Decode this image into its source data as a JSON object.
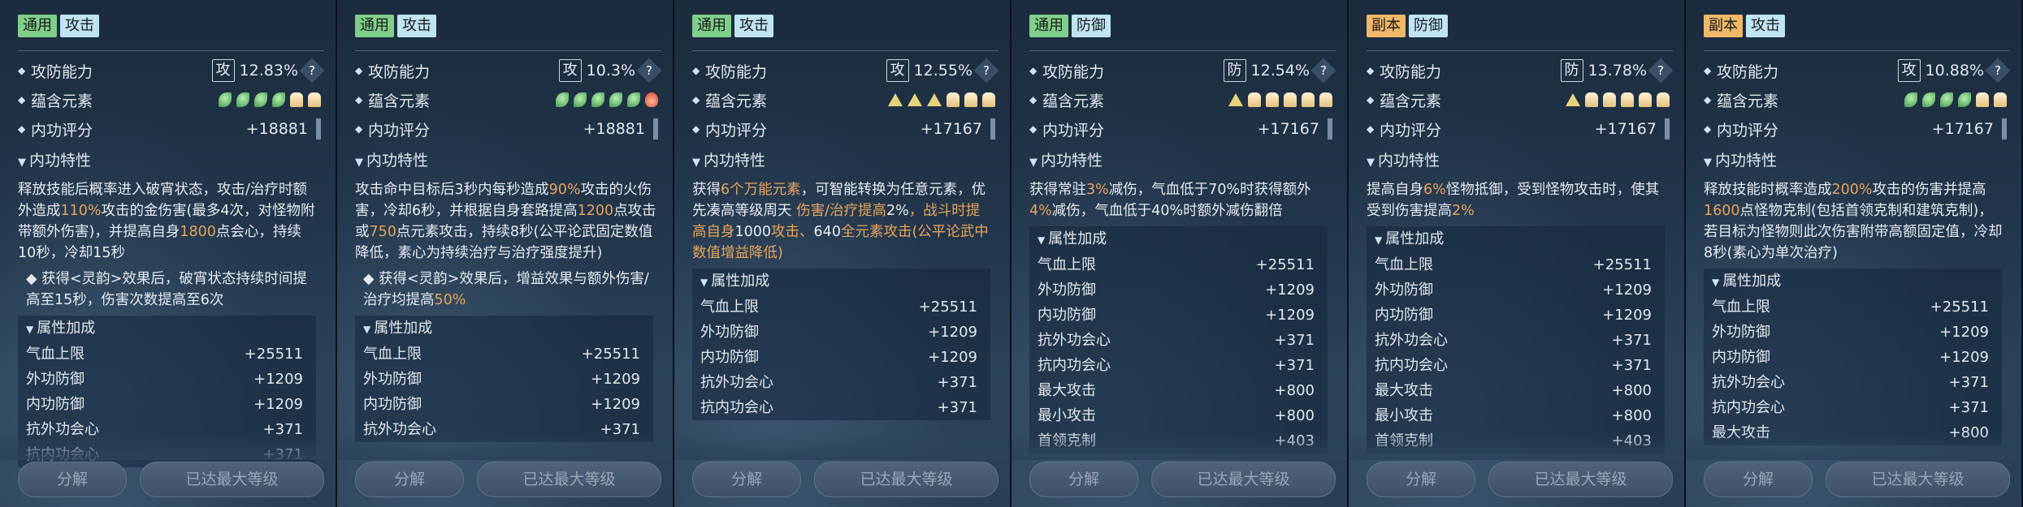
{
  "cards": [
    {
      "tags": [
        "通用",
        "攻击"
      ],
      "labels": {
        "power": "攻防能力",
        "elements": "蕴含元素",
        "score": "内功评分",
        "traits": "内功特性",
        "attrs": "属性加成"
      },
      "power_badge": "攻",
      "power_value": "12.83%",
      "qmark": "?",
      "elements": [
        "leaf",
        "leaf",
        "leaf",
        "leaf",
        "bell",
        "bell"
      ],
      "score": "+18881",
      "desc_parts": [
        "释放技能后概率进入破宵状态，攻击/治疗时额外造成",
        "110%",
        "攻击的金伤害(最多4次，对怪物附带额外伤害)，并提高自身",
        "1800",
        "点会心，持续10秒，冷却15秒"
      ],
      "sub": "◆ 获得<灵韵>效果后，破宵状态持续时间提高至15秒，伤害次数提高至6次",
      "attrs": [
        [
          "气血上限",
          "+25511"
        ],
        [
          "外功防御",
          "+1209"
        ],
        [
          "内功防御",
          "+1209"
        ],
        [
          "抗外功会心",
          "+371"
        ],
        [
          "抗内功会心",
          "+371"
        ]
      ],
      "btn_break": "分解",
      "btn_max": "已达最大等级"
    },
    {
      "tags": [
        "通用",
        "攻击"
      ],
      "labels": {
        "power": "攻防能力",
        "elements": "蕴含元素",
        "score": "内功评分",
        "traits": "内功特性",
        "attrs": "属性加成"
      },
      "power_badge": "攻",
      "power_value": "10.3%",
      "qmark": "?",
      "elements": [
        "leaf",
        "leaf",
        "leaf",
        "leaf",
        "leaf",
        "fire"
      ],
      "score": "+18881",
      "desc_parts": [
        "攻击命中目标后3秒内每秒造成",
        "90%",
        "攻击的火伤害，冷却6秒，并根据自身套路提高",
        "1200",
        "点攻击或",
        "750",
        "点元素攻击，持续8秒(公平论武固定数值降低，素心为持续治疗与治疗强度提升)"
      ],
      "sub": "◆ 获得<灵韵>效果后，增益效果与额外伤害/治疗均提高",
      "sub_hl": "50%",
      "attrs": [
        [
          "气血上限",
          "+25511"
        ],
        [
          "外功防御",
          "+1209"
        ],
        [
          "内功防御",
          "+1209"
        ],
        [
          "抗外功会心",
          "+371"
        ]
      ],
      "btn_break": "分解",
      "btn_max": "已达最大等级"
    },
    {
      "tags": [
        "通用",
        "攻击"
      ],
      "labels": {
        "power": "攻防能力",
        "elements": "蕴含元素",
        "score": "内功评分",
        "traits": "内功特性",
        "attrs": "属性加成"
      },
      "power_badge": "攻",
      "power_value": "12.55%",
      "qmark": "?",
      "elements": [
        "tri",
        "tri",
        "tri",
        "bell",
        "bell",
        "bell"
      ],
      "score": "+17167",
      "desc_parts": [
        "获得",
        "6个万能元素",
        "，可智能转换为任意元素，优先凑高等级周天",
        "\n伤害/治疗提高",
        "2%",
        "，战斗时提高自身",
        "1000",
        "攻击、",
        "640",
        "全元素攻击(公平论武中数值增益降低)"
      ],
      "attrs": [
        [
          "气血上限",
          "+25511"
        ],
        [
          "外功防御",
          "+1209"
        ],
        [
          "内功防御",
          "+1209"
        ],
        [
          "抗外功会心",
          "+371"
        ],
        [
          "抗内功会心",
          "+371"
        ]
      ],
      "btn_break": "分解",
      "btn_max": "已达最大等级"
    },
    {
      "tags": [
        "通用",
        "防御"
      ],
      "labels": {
        "power": "攻防能力",
        "elements": "蕴含元素",
        "score": "内功评分",
        "traits": "内功特性",
        "attrs": "属性加成"
      },
      "power_badge": "防",
      "power_value": "12.54%",
      "qmark": "?",
      "elements": [
        "tri",
        "bell",
        "bell",
        "bell",
        "bell",
        "bell"
      ],
      "score": "+17167",
      "desc_parts": [
        "获得常驻",
        "3%",
        "减伤，气血低于70%时获得额外",
        "4%",
        "减伤，气血低于40%时额外减伤翻倍"
      ],
      "attrs": [
        [
          "气血上限",
          "+25511"
        ],
        [
          "外功防御",
          "+1209"
        ],
        [
          "内功防御",
          "+1209"
        ],
        [
          "抗外功会心",
          "+371"
        ],
        [
          "抗内功会心",
          "+371"
        ],
        [
          "最大攻击",
          "+800"
        ],
        [
          "最小攻击",
          "+800"
        ],
        [
          "首领克制",
          "+403"
        ]
      ],
      "btn_break": "分解",
      "btn_max": "已达最大等级"
    },
    {
      "tags": [
        "副本",
        "防御"
      ],
      "labels": {
        "power": "攻防能力",
        "elements": "蕴含元素",
        "score": "内功评分",
        "traits": "内功特性",
        "attrs": "属性加成"
      },
      "power_badge": "防",
      "power_value": "13.78%",
      "qmark": "?",
      "elements": [
        "tri",
        "bell",
        "bell",
        "bell",
        "bell",
        "bell"
      ],
      "score": "+17167",
      "desc_parts": [
        "提高自身",
        "6%",
        "怪物抵御，受到怪物攻击时，使其受到伤害提高",
        "2%"
      ],
      "attrs": [
        [
          "气血上限",
          "+25511"
        ],
        [
          "外功防御",
          "+1209"
        ],
        [
          "内功防御",
          "+1209"
        ],
        [
          "抗外功会心",
          "+371"
        ],
        [
          "抗内功会心",
          "+371"
        ],
        [
          "最大攻击",
          "+800"
        ],
        [
          "最小攻击",
          "+800"
        ],
        [
          "首领克制",
          "+403"
        ]
      ],
      "btn_break": "分解",
      "btn_max": "已达最大等级"
    },
    {
      "tags": [
        "副本",
        "攻击"
      ],
      "labels": {
        "power": "攻防能力",
        "elements": "蕴含元素",
        "score": "内功评分",
        "traits": "内功特性",
        "attrs": "属性加成"
      },
      "power_badge": "攻",
      "power_value": "10.88%",
      "qmark": "?",
      "elements": [
        "leaf",
        "leaf",
        "leaf",
        "leaf",
        "bell",
        "bell"
      ],
      "score": "+17167",
      "desc_parts": [
        "释放技能时概率造成",
        "200%",
        "攻击的伤害并提高",
        "1600",
        "点怪物克制(包括首领克制和建筑克制)，若目标为怪物则此次伤害附带高额固定值，冷却8秒(素心为单次治疗)"
      ],
      "attrs": [
        [
          "气血上限",
          "+25511"
        ],
        [
          "外功防御",
          "+1209"
        ],
        [
          "内功防御",
          "+1209"
        ],
        [
          "抗外功会心",
          "+371"
        ],
        [
          "抗内功会心",
          "+371"
        ],
        [
          "最大攻击",
          "+800"
        ]
      ],
      "btn_break": "分解",
      "btn_max": "已达最大等级"
    }
  ]
}
